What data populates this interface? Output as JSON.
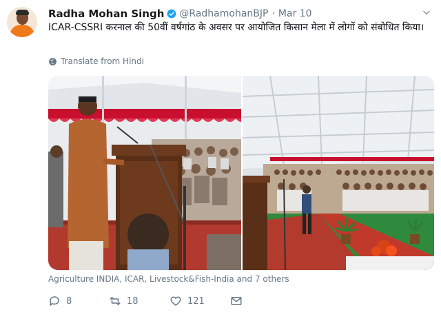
{
  "tweet": {
    "author_name": "Radha Mohan Singh",
    "author_handle": "@RadhamohanBJP",
    "separator": "·",
    "date": "Mar 10",
    "text": "ICAR-CSSRI करनाल की 50वीं वर्षगांठ के अवसर पर आयोजित किसान मेला में लोगों को संबोधित किया।",
    "translate_label": "Translate from Hindi",
    "tagged": "Agriculture INDIA, ICAR, Livestock&Fish-India and 7 others"
  },
  "actions": {
    "reply_count": "8",
    "retweet_count": "18",
    "like_count": "121"
  },
  "icons": {
    "verified": "verified-badge-icon",
    "more": "chevron-down-icon",
    "translate": "globe-icon",
    "reply": "reply-icon",
    "retweet": "retweet-icon",
    "like": "heart-icon",
    "dm": "envelope-icon"
  },
  "colors": {
    "accent": "#1da1f2",
    "muted": "#657786",
    "text": "#14171a"
  }
}
